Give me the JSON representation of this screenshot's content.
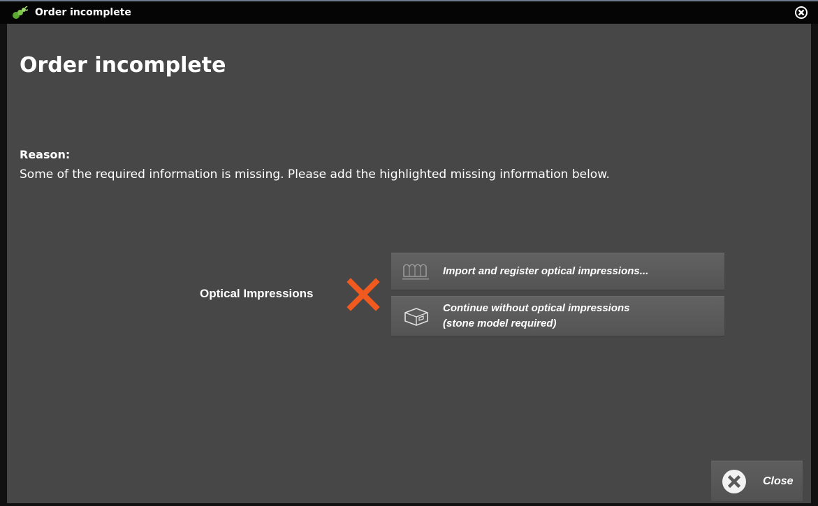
{
  "window": {
    "title": "Order incomplete"
  },
  "dialog": {
    "heading": "Order incomplete",
    "reason_label": "Reason:",
    "reason_text": "Some of the required information is missing. Please add the highlighted missing information below."
  },
  "items": [
    {
      "label": "Optical Impressions",
      "status_icon": "missing-x-icon",
      "status_color": "#f05a1e",
      "actions": [
        {
          "icon": "teeth-scan-icon",
          "lines": [
            "Import and register optical impressions..."
          ]
        },
        {
          "icon": "stone-model-box-icon",
          "lines": [
            "Continue without optical impressions",
            "(stone model required)"
          ]
        }
      ]
    }
  ],
  "footer": {
    "close_label": "Close",
    "close_icon": "close-icon"
  },
  "colors": {
    "background": "#474747",
    "titlebar": "#050505",
    "button": "#5a5a5a",
    "accent_icon": "#6fbf3a"
  }
}
